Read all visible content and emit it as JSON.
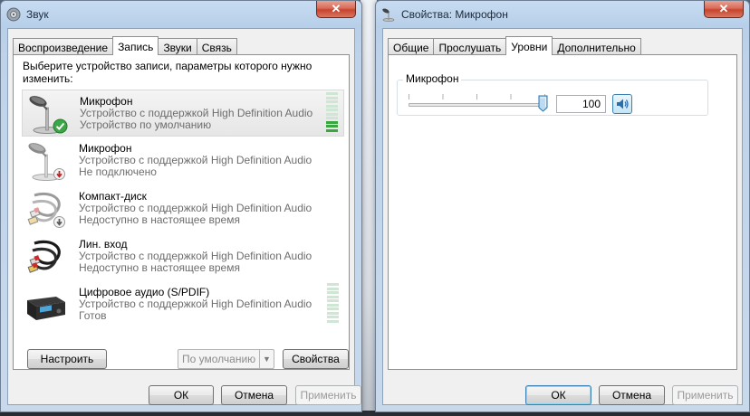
{
  "left_window": {
    "title": "Звук",
    "close_label": "✕",
    "tabs": [
      {
        "label": "Воспроизведение",
        "active": false
      },
      {
        "label": "Запись",
        "active": true
      },
      {
        "label": "Звуки",
        "active": false
      },
      {
        "label": "Связь",
        "active": false
      }
    ],
    "instruction": "Выберите устройство записи, параметры которого нужно изменить:",
    "devices": [
      {
        "name": "Микрофон",
        "description": "Устройство с поддержкой High Definition Audio",
        "status": "Устройство по умолчанию",
        "icon": "microphone-icon",
        "badge": "default-check",
        "meter_level": 0.25,
        "selected": true
      },
      {
        "name": "Микрофон",
        "description": "Устройство с поддержкой High Definition Audio",
        "status": "Не подключено",
        "icon": "microphone-icon",
        "badge": "unplugged-arrow",
        "selected": false
      },
      {
        "name": "Компакт-диск",
        "description": "Устройство с поддержкой High Definition Audio",
        "status": "Недоступно в настоящее время",
        "icon": "rca-cable-icon",
        "badge": "disabled-arrow",
        "selected": false
      },
      {
        "name": "Лин. вход",
        "description": "Устройство с поддержкой High Definition Audio",
        "status": "Недоступно в настоящее время",
        "icon": "rca-cable-icon",
        "badge": "none",
        "selected": false
      },
      {
        "name": "Цифровое аудио (S/PDIF)",
        "description": "Устройство с поддержкой High Definition Audio",
        "status": "Готов",
        "icon": "digital-receiver-icon",
        "badge": "none",
        "meter_level": 0,
        "selected": false
      }
    ],
    "configure_label": "Настроить",
    "set_default_label": "По умолчанию",
    "properties_label": "Свойства",
    "ok_label": "ОК",
    "cancel_label": "Отмена",
    "apply_label": "Применить"
  },
  "right_window": {
    "title": "Свойства: Микрофон",
    "close_label": "✕",
    "tabs": [
      {
        "label": "Общие",
        "active": false
      },
      {
        "label": "Прослушать",
        "active": false
      },
      {
        "label": "Уровни",
        "active": true
      },
      {
        "label": "Дополнительно",
        "active": false
      }
    ],
    "group_label": "Микрофон",
    "level_value": "100",
    "ok_label": "ОК",
    "cancel_label": "Отмена",
    "apply_label": "Применить"
  },
  "colors": {
    "meter_on": "#3aa640",
    "meter_off": "#cfe6d4",
    "title_bar": "#b7cfe8",
    "close_red": "#c7442d"
  }
}
